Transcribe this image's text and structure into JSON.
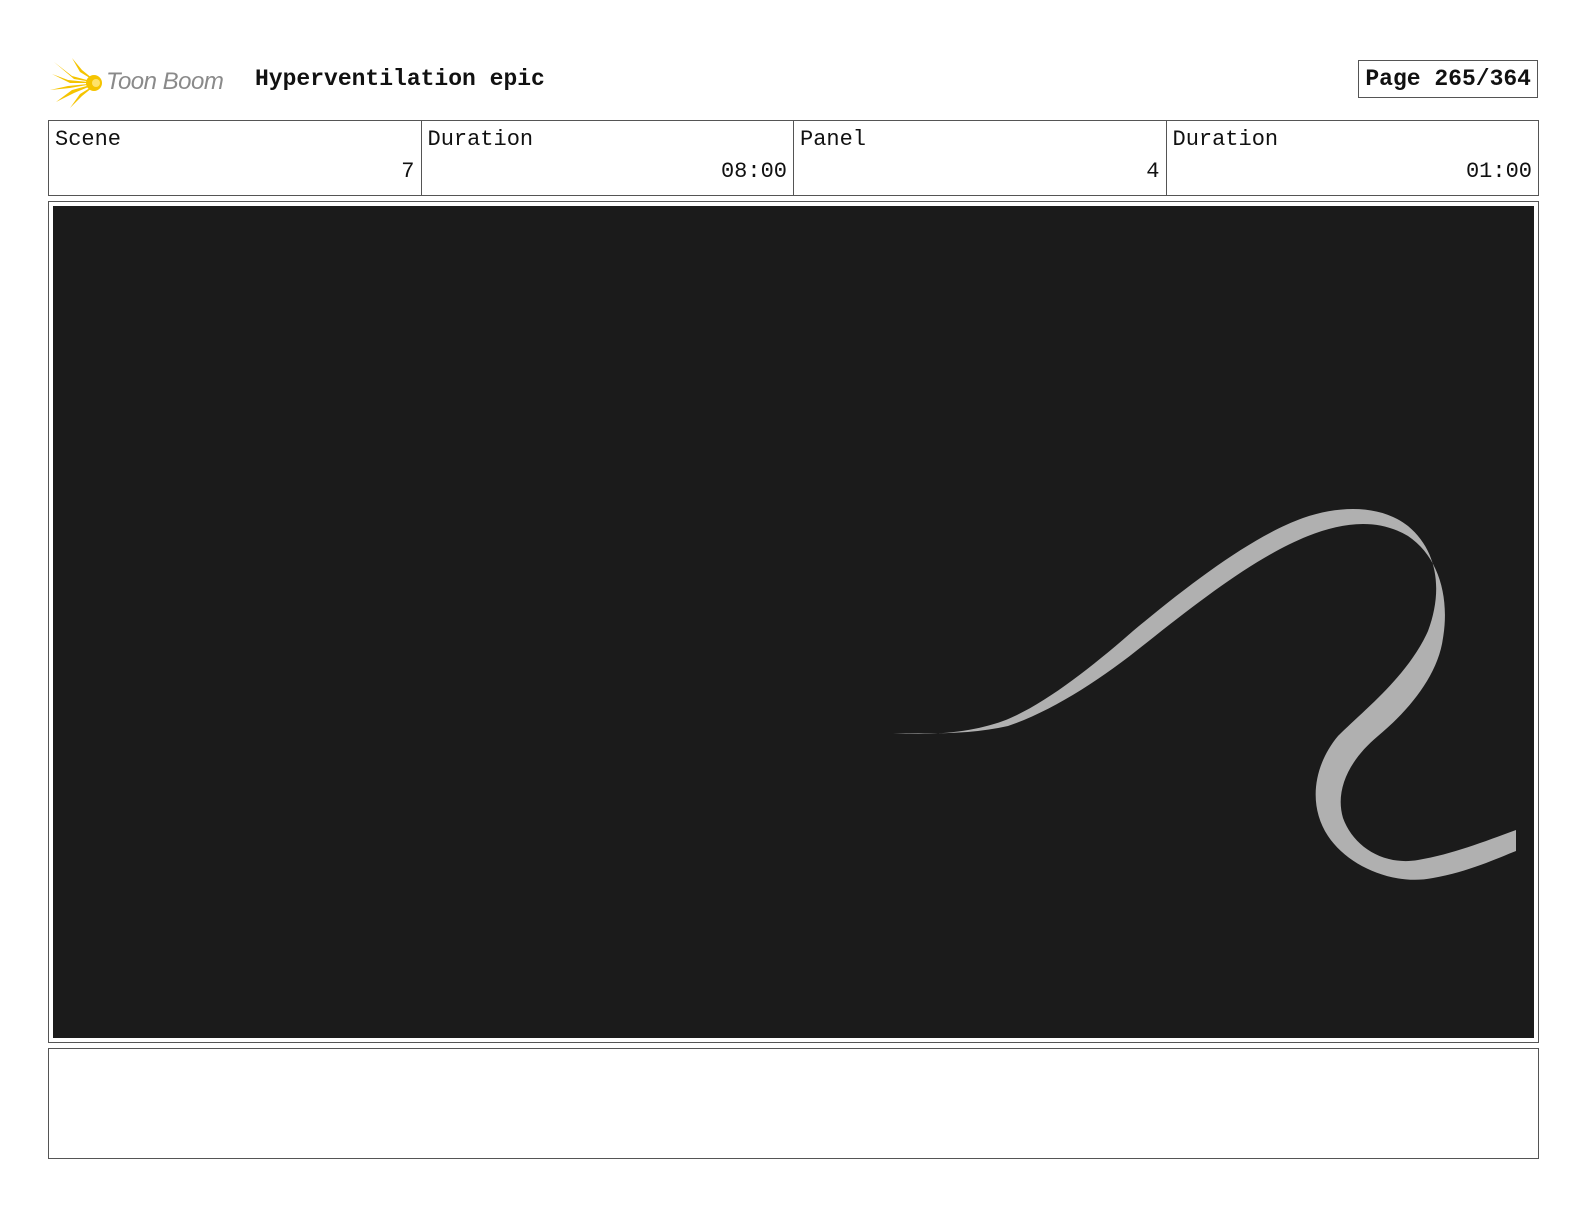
{
  "header": {
    "logo_text": "Toon Boom",
    "project_title": "Hyperventilation epic",
    "page_label": "Page 265/364"
  },
  "info": {
    "scene_label": "Scene",
    "scene_value": "7",
    "scene_duration_label": "Duration",
    "scene_duration_value": "08:00",
    "panel_label": "Panel",
    "panel_value": "4",
    "panel_duration_label": "Duration",
    "panel_duration_value": "01:00"
  },
  "colors": {
    "panel_background": "#1b1b1b",
    "stroke_fill": "#b0b0b0",
    "logo_yellow": "#f5c400",
    "logo_text": "#8a8a8a"
  },
  "notes": {
    "text": ""
  }
}
